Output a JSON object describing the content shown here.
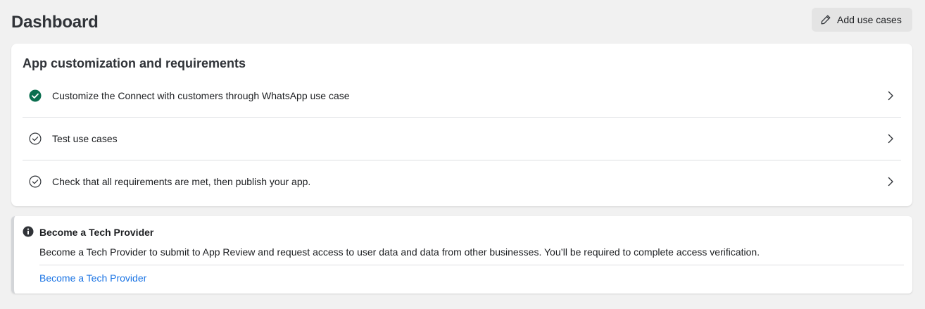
{
  "header": {
    "title": "Dashboard",
    "add_use_cases_label": "Add use cases"
  },
  "customization": {
    "title": "App customization and requirements",
    "tasks": [
      {
        "label": "Customize the Connect with customers through WhatsApp use case",
        "status": "complete"
      },
      {
        "label": "Test use cases",
        "status": "incomplete"
      },
      {
        "label": "Check that all requirements are met, then publish your app.",
        "status": "incomplete"
      }
    ]
  },
  "tech_provider_notice": {
    "title": "Become a Tech Provider",
    "body": "Become a Tech Provider to submit to App Review and request access to user data and data from other businesses. You’ll be required to complete access verification.",
    "link_label": "Become a Tech Provider"
  },
  "colors": {
    "complete_green": "#0b6e4f",
    "link_blue": "#1b74e4",
    "icon_gray": "#303338"
  },
  "icons": {
    "add_button": "pencil-icon",
    "task_complete": "check-circle-filled-icon",
    "task_incomplete": "check-circle-outline-icon",
    "task_chevron": "chevron-right-icon",
    "notice": "info-icon"
  }
}
